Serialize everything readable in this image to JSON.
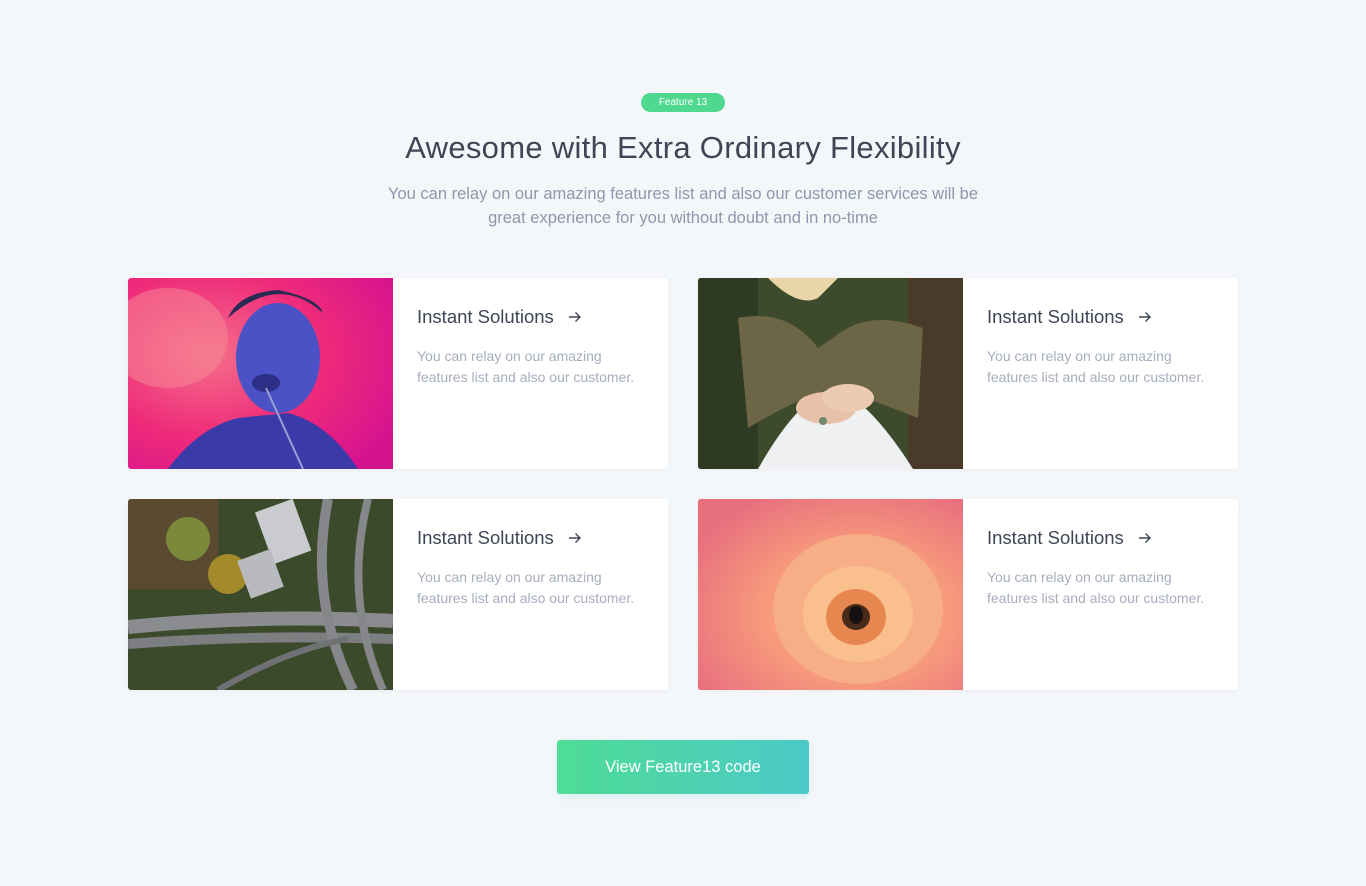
{
  "header": {
    "badge": "Feature 13",
    "title": "Awesome with Extra Ordinary Flexibility",
    "subtitle": "You can relay on our amazing features list and also our customer services will be great experience for you without doubt and in no-time"
  },
  "cards": [
    {
      "title": "Instant Solutions",
      "text": "You can relay on our amazing features list and also our customer.",
      "image": "man-with-blue-paint-photo",
      "icon": "arrow-right-icon"
    },
    {
      "title": "Instant Solutions",
      "text": "You can relay on our amazing features list and also our customer.",
      "image": "woman-hands-rings-photo",
      "icon": "arrow-right-icon"
    },
    {
      "title": "Instant Solutions",
      "text": "You can relay on our amazing features list and also our customer.",
      "image": "aerial-highway-photo",
      "icon": "arrow-right-icon"
    },
    {
      "title": "Instant Solutions",
      "text": "You can relay on our amazing features list and also our customer.",
      "image": "orange-rose-with-bee-photo",
      "icon": "arrow-right-icon"
    }
  ],
  "cta": {
    "label": "View Feature13 code"
  },
  "colors": {
    "background": "#f4f7fa",
    "badge": "#4fd98f",
    "heading": "#3e4555",
    "muted": "#8d97ad",
    "cta_gradient_start": "#4fdc96",
    "cta_gradient_end": "#4cc9c8"
  }
}
